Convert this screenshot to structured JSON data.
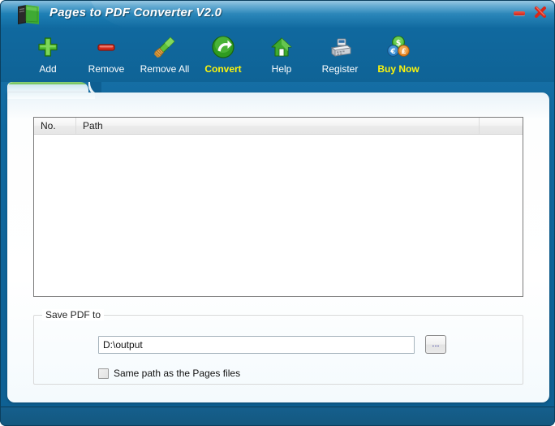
{
  "window": {
    "title": "Pages to PDF Converter V2.0",
    "app_icon": "book-icon",
    "minimize_label": "",
    "close_label": "",
    "accent_color": "#fbf40d",
    "titlebar_color": "#1b7cb2",
    "frame_color": "#0e5f92"
  },
  "toolbar": {
    "items": [
      {
        "label": "Add",
        "icon": "plus-icon",
        "accent": false
      },
      {
        "label": "Remove",
        "icon": "minus-icon",
        "accent": false
      },
      {
        "label": "Remove All",
        "icon": "broom-icon",
        "accent": false
      },
      {
        "label": "Convert",
        "icon": "convert-arrow-icon",
        "accent": true
      },
      {
        "label": "Help",
        "icon": "home-icon",
        "accent": false
      },
      {
        "label": "Register",
        "icon": "cash-register-icon",
        "accent": false
      },
      {
        "label": "Buy Now",
        "icon": "coins-icon",
        "accent": true
      }
    ]
  },
  "tab": {
    "label": ""
  },
  "filelist": {
    "columns": [
      "No.",
      "Path",
      ""
    ],
    "rows": []
  },
  "output": {
    "group_title": "Save PDF to",
    "path_value": "D:\\output",
    "path_placeholder": "",
    "browse_label": "...",
    "same_path_label": "Same path as the Pages files",
    "same_path_checked": false
  }
}
